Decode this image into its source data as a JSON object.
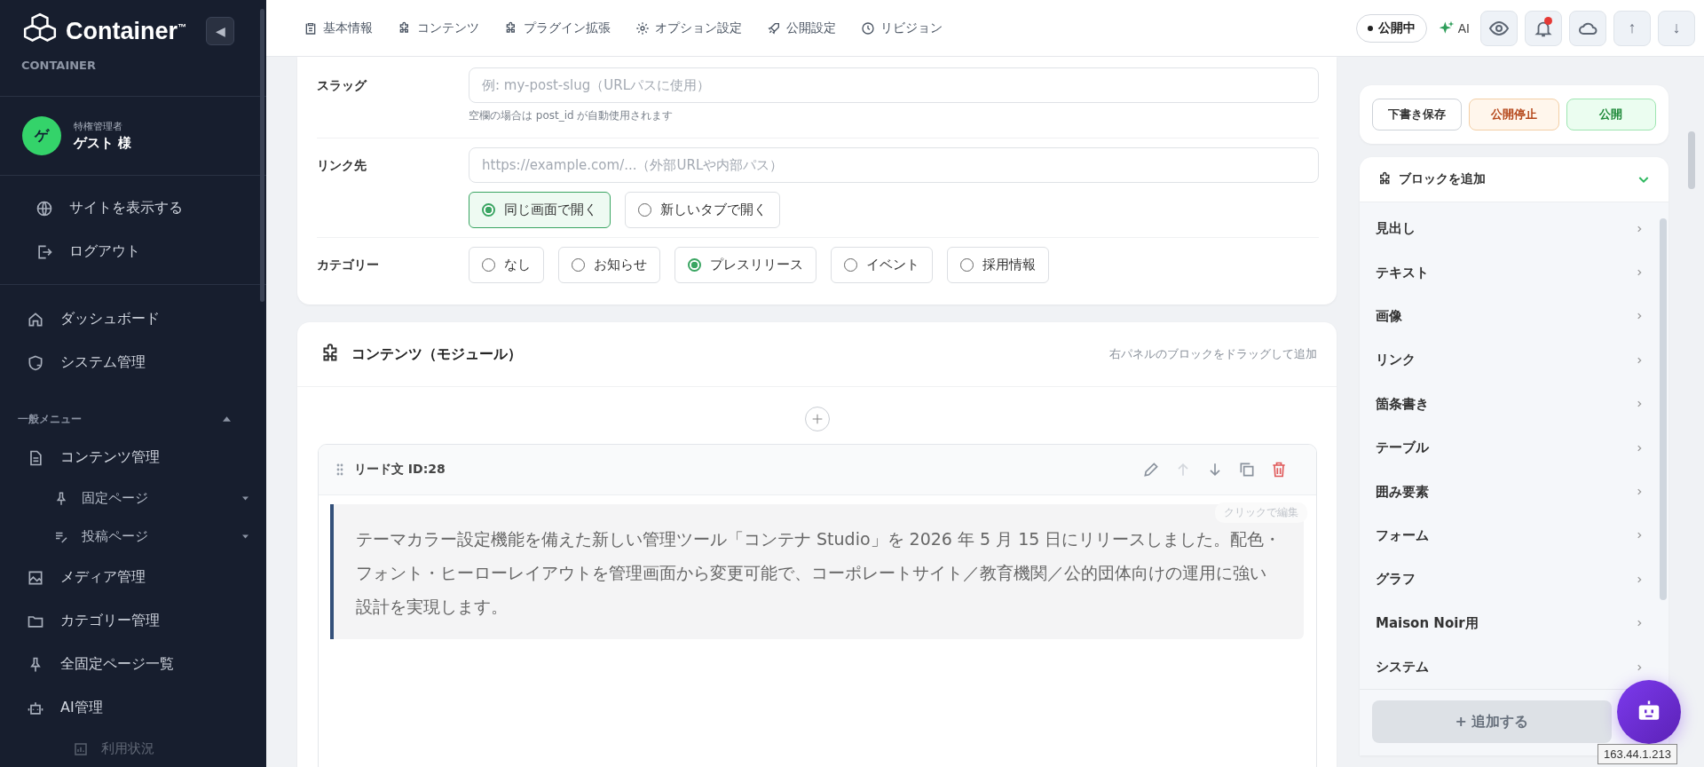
{
  "sidebar": {
    "logo": "Container",
    "trademark": "™",
    "subtitle": "CONTAINER",
    "collapse_button": "◀",
    "user": {
      "avatar": "ゲ",
      "role": "特権管理者",
      "name": "ゲスト 様"
    },
    "links": [
      {
        "label": "サイトを表示する"
      },
      {
        "label": "ログアウト"
      }
    ],
    "nav": [
      {
        "label": "ダッシュボード"
      },
      {
        "label": "システム管理"
      }
    ],
    "section": {
      "title": "一般メニュー",
      "expanded": true,
      "items": [
        {
          "label": "コンテンツ管理",
          "children": [
            {
              "label": "固定ページ",
              "expanded": false
            },
            {
              "label": "投稿ページ",
              "expanded": false
            }
          ]
        },
        {
          "label": "メディア管理"
        },
        {
          "label": "カテゴリー管理"
        },
        {
          "label": "全固定ページ一覧"
        },
        {
          "label": "AI管理",
          "children": [
            {
              "label": "利用状況"
            }
          ]
        }
      ]
    }
  },
  "topbar": {
    "tabs": [
      {
        "label": "基本情報"
      },
      {
        "label": "コンテンツ"
      },
      {
        "label": "プラグイン拡張"
      },
      {
        "label": "オプション設定"
      },
      {
        "label": "公開設定"
      },
      {
        "label": "リビジョン"
      }
    ],
    "status": "公開中",
    "ai": "AI",
    "notification": true,
    "up": "↑",
    "down": "↓"
  },
  "form": {
    "slug": {
      "label": "スラッグ",
      "placeholder": "例: my-post-slug（URLパスに使用）",
      "help": "空欄の場合は post_id が自動使用されます"
    },
    "link": {
      "label": "リンク先",
      "placeholder": "https://example.com/...（外部URLや内部パス）",
      "options": [
        {
          "label": "同じ画面で開く",
          "selected": true
        },
        {
          "label": "新しいタブで開く",
          "selected": false
        }
      ]
    },
    "category": {
      "label": "カテゴリー",
      "options": [
        {
          "label": "なし",
          "selected": false
        },
        {
          "label": "お知らせ",
          "selected": false
        },
        {
          "label": "プレスリリース",
          "selected": true
        },
        {
          "label": "イベント",
          "selected": false
        },
        {
          "label": "採用情報",
          "selected": false
        }
      ]
    }
  },
  "content": {
    "title": "コンテンツ（モジュール）",
    "hint": "右パネルのブロックをドラッグして追加",
    "block": {
      "title": "リード文 ID:28",
      "actions": [
        {
          "disabled": false
        },
        {
          "disabled": true
        },
        {
          "disabled": false
        },
        {
          "disabled": false
        },
        {
          "disabled": false
        }
      ],
      "edit_badge": "クリックで編集",
      "text": "テーマカラー設定機能を備えた新しい管理ツール「コンテナ Studio」を 2026 年 5 月 15 日にリリースしました。配色・フォント・ヒーローレイアウトを管理画面から変更可能で、コーポレートサイト／教育機関／公的団体向けの運用に強い設計を実現します。"
    }
  },
  "panel": {
    "buttons": [
      {
        "label": "下書き保存",
        "kind": "draft"
      },
      {
        "label": "公開停止",
        "kind": "unpublish"
      },
      {
        "label": "公開",
        "kind": "publish"
      }
    ],
    "blocks": {
      "title": "ブロックを追加",
      "expanded": true,
      "items": [
        {
          "label": "見出し"
        },
        {
          "label": "テキスト"
        },
        {
          "label": "画像"
        },
        {
          "label": "リンク"
        },
        {
          "label": "箇条書き"
        },
        {
          "label": "テーブル"
        },
        {
          "label": "囲み要素"
        },
        {
          "label": "フォーム"
        },
        {
          "label": "グラフ"
        },
        {
          "label": "Maison Noir用"
        },
        {
          "label": "システム"
        }
      ],
      "add_button": {
        "label": "+ 追加する",
        "disabled": true
      }
    }
  },
  "ip": "163.44.1.213"
}
